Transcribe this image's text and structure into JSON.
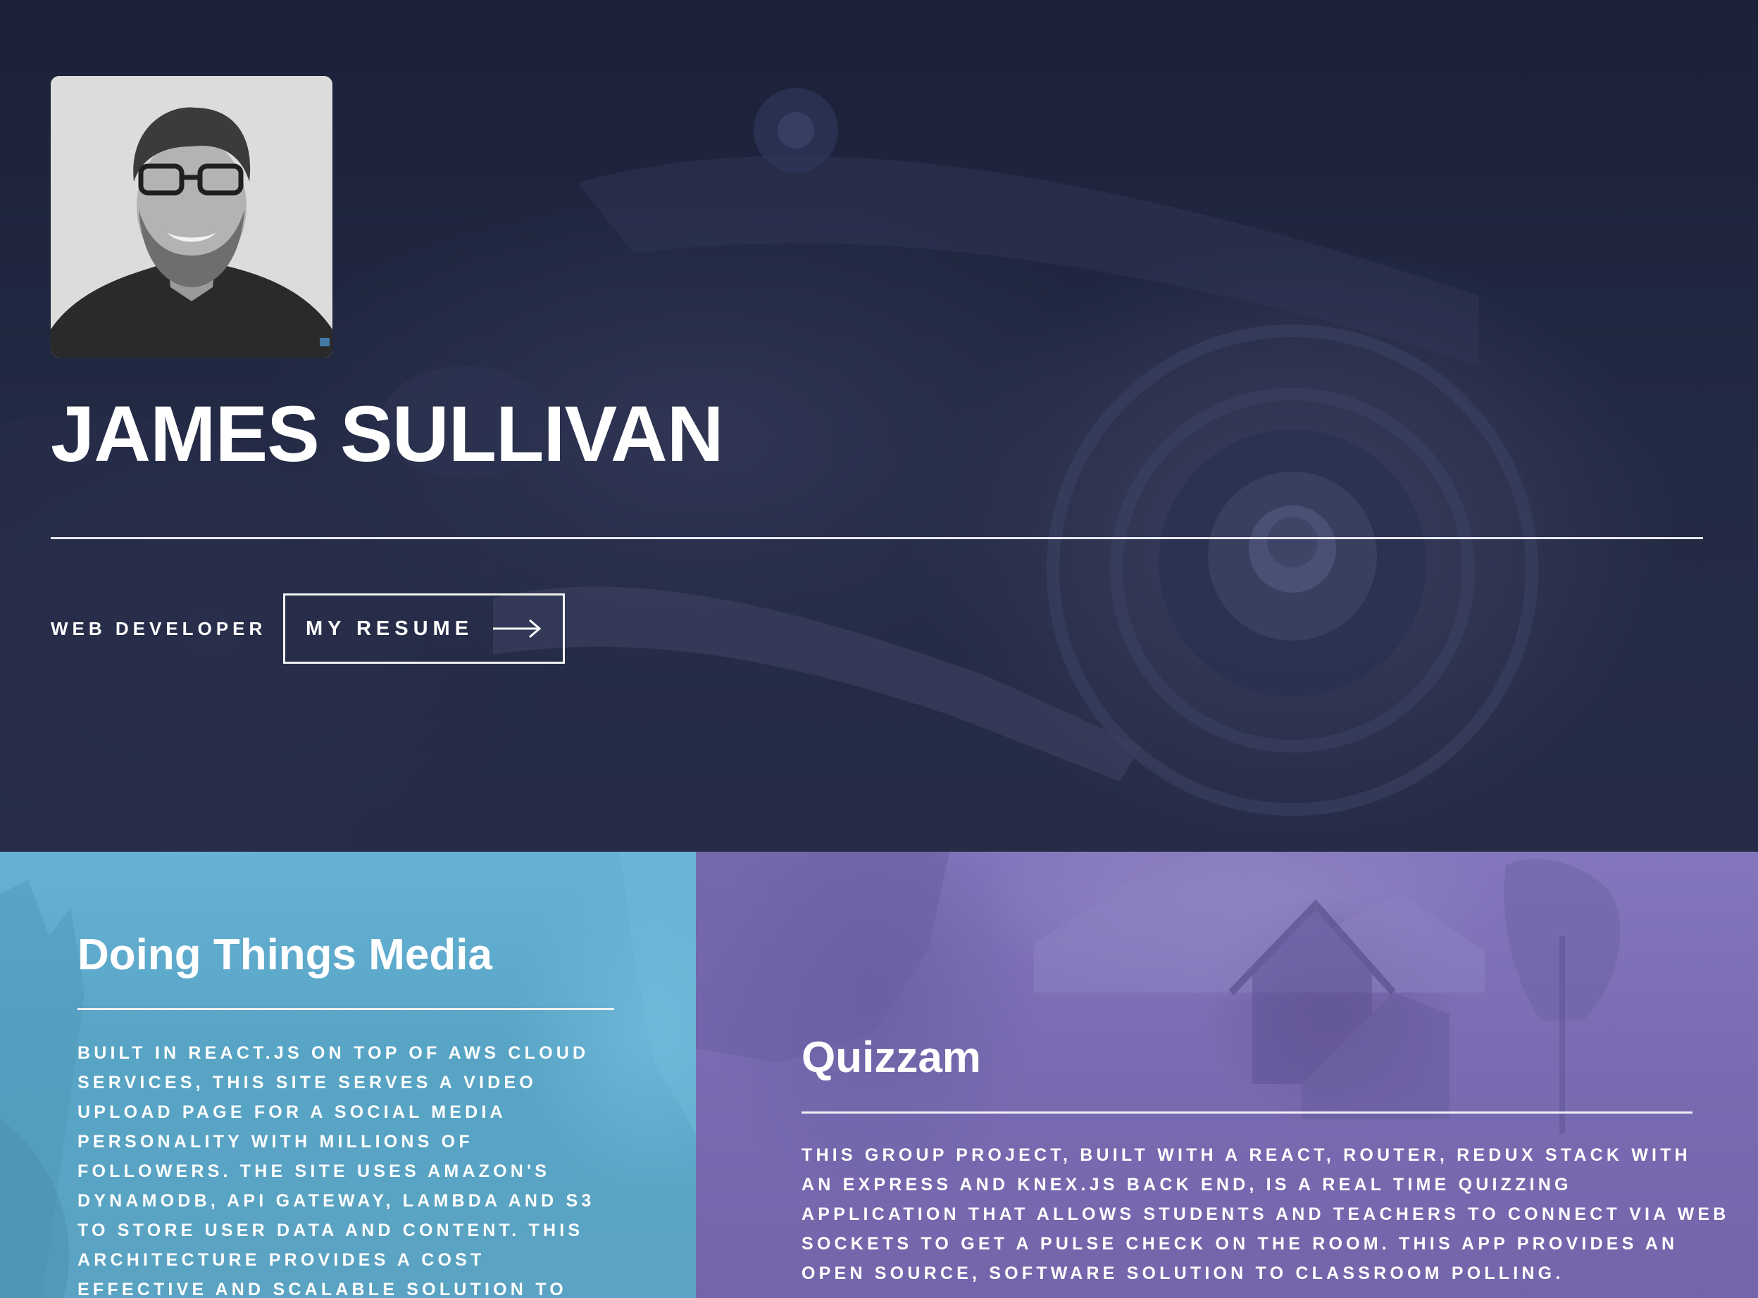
{
  "hero": {
    "name": "JAMES SULLIVAN",
    "role": "WEB DEVELOPER",
    "resume_button": "MY RESUME",
    "avatar_icon": "portrait-photo",
    "resume_icon": "arrow-right-icon"
  },
  "projects": [
    {
      "title": "Doing Things Media",
      "description": "BUILT IN REACT.JS ON TOP OF AWS CLOUD SERVICES, THIS SITE SERVES A VIDEO UPLOAD PAGE FOR A SOCIAL MEDIA PERSONALITY WITH MILLIONS OF FOLLOWERS. THE SITE USES AMAZON'S DYNAMODB, API GATEWAY, LAMBDA AND S3 TO STORE USER DATA AND CONTENT. THIS ARCHITECTURE PROVIDES A COST EFFECTIVE AND SCALABLE SOLUTION TO",
      "color": "#5aa6c8"
    },
    {
      "title": "Quizzam",
      "description": "THIS GROUP PROJECT, BUILT WITH A REACT, ROUTER, REDUX STACK WITH AN EXPRESS AND KNEX.JS BACK END, IS A REAL TIME QUIZZING APPLICATION THAT ALLOWS STUDENTS AND TEACHERS TO CONNECT VIA WEB SOCKETS TO GET A PULSE CHECK ON THE ROOM. THIS APP PROVIDES AN OPEN SOURCE, SOFTWARE SOLUTION TO CLASSROOM POLLING.",
      "color": "#7a6bb3"
    }
  ],
  "colors": {
    "hero_overlay": "#1c2338",
    "text": "#ffffff"
  }
}
